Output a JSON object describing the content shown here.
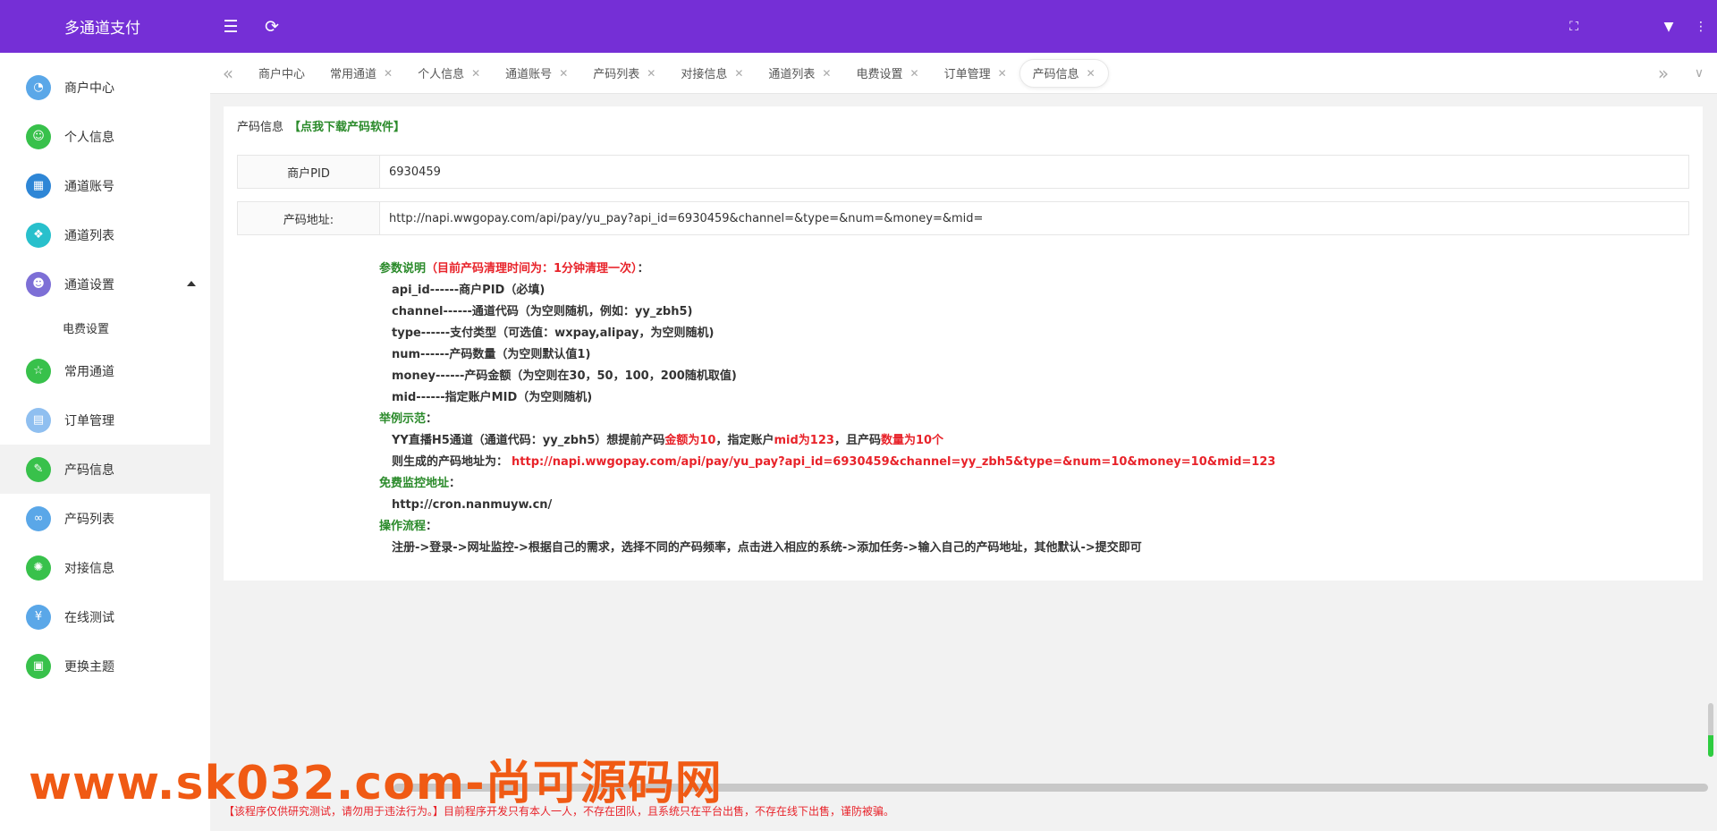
{
  "app": {
    "title": "多通道支付"
  },
  "colors": {
    "header": "#752fd6",
    "green": "#2a8a2a",
    "red": "#e8232a",
    "watermark": "#f05a14"
  },
  "header": {
    "menu_icon": "menu-fold-icon",
    "refresh_icon": "refresh-icon",
    "fullscreen_icon": "fullscreen-icon",
    "dropdown_icon": "caret-down-icon",
    "more_icon": "more-vertical-icon"
  },
  "sidebar": {
    "items": [
      {
        "label": "商户中心",
        "icon": "dashboard-icon",
        "color": "#5aa7e8",
        "glyph": "◔"
      },
      {
        "label": "个人信息",
        "icon": "user-icon",
        "color": "#38c14b",
        "glyph": "☺"
      },
      {
        "label": "通道账号",
        "icon": "grid-icon",
        "color": "#2e86d6",
        "glyph": "▦"
      },
      {
        "label": "通道列表",
        "icon": "apps-icon",
        "color": "#28c0cc",
        "glyph": "❖"
      },
      {
        "label": "通道设置",
        "icon": "users-icon",
        "color": "#7d6fd6",
        "glyph": "☻"
      },
      {
        "label": "常用通道",
        "icon": "star-icon",
        "color": "#38c14b",
        "glyph": "☆"
      },
      {
        "label": "订单管理",
        "icon": "document-icon",
        "color": "#8fbff0",
        "glyph": "▤"
      },
      {
        "label": "产码信息",
        "icon": "edit-icon",
        "color": "#38c14b",
        "glyph": "✎"
      },
      {
        "label": "产码列表",
        "icon": "link-icon",
        "color": "#5aa7e8",
        "glyph": "∞"
      },
      {
        "label": "对接信息",
        "icon": "settings-icon",
        "color": "#38c14b",
        "glyph": "✺"
      },
      {
        "label": "在线测试",
        "icon": "yen-icon",
        "color": "#5aa7e8",
        "glyph": "¥"
      },
      {
        "label": "更换主题",
        "icon": "theme-icon",
        "color": "#38c14b",
        "glyph": "▣"
      }
    ],
    "sub_items": [
      {
        "label": "电费设置"
      }
    ]
  },
  "tabs": [
    {
      "label": "商户中心"
    },
    {
      "label": "常用通道"
    },
    {
      "label": "个人信息"
    },
    {
      "label": "通道账号"
    },
    {
      "label": "产码列表"
    },
    {
      "label": "对接信息"
    },
    {
      "label": "通道列表"
    },
    {
      "label": "电费设置"
    },
    {
      "label": "订单管理"
    },
    {
      "label": "产码信息"
    }
  ],
  "page": {
    "title": "产码信息",
    "download_link": "【点我下载产码软件】",
    "pid_label": "商户PID",
    "pid_value": "6930459",
    "url_label": "产码地址:",
    "url_value": "http://napi.wwgopay.com/api/pay/yu_pay?api_id=6930459&channel=&type=&num=&money=&mid="
  },
  "doc": {
    "params_heading": "参数说明",
    "params_note": "（目前产码清理时间为：1分钟清理一次）",
    "params_colon": "：",
    "params": [
      "api_id------商户PID（必填)",
      "channel------通道代码（为空则随机，例如：yy_zbh5)",
      "type------支付类型（可选值：wxpay,alipay，为空则随机)",
      "num------产码数量（为空则默认值1)",
      "money------产码金额（为空则在30，50，100，200随机取值)",
      "mid------指定账户MID（为空则随机)"
    ],
    "example_heading": "举例示范",
    "example_colon": "：",
    "example_line1_a": "YY直播H5通道（通道代码：yy_zbh5）想提前产码",
    "example_line1_b": "金额为10",
    "example_line1_c": "，指定账户",
    "example_line1_d": "mid为123",
    "example_line1_e": "，且产码",
    "example_line1_f": "数量为10个",
    "example_line2_a": "则生成的产码地址为：",
    "example_line2_b": "http://napi.wwgopay.com/api/pay/yu_pay?api_id=6930459&channel=yy_zbh5&type=&num=10&money=10&mid=123",
    "monitor_heading": "免费监控地址",
    "monitor_colon": "：",
    "monitor_url": "http://cron.nanmuyw.cn/",
    "flow_heading": "操作流程",
    "flow_colon": "：",
    "flow_text": "注册->登录->网址监控->根据自己的需求，选择不同的产码频率，点击进入相应的系统->添加任务->输入自己的产码地址，其他默认->提交即可"
  },
  "watermark": "www.sk032.com-尚可源码网",
  "footer": "【该程序仅供研究测试，请勿用于违法行为。】目前程序开发只有本人一人，不存在团队，且系统只在平台出售，不存在线下出售，谨防被骗。",
  "vertical_scroll": {
    "position_fraction": 0.95
  }
}
